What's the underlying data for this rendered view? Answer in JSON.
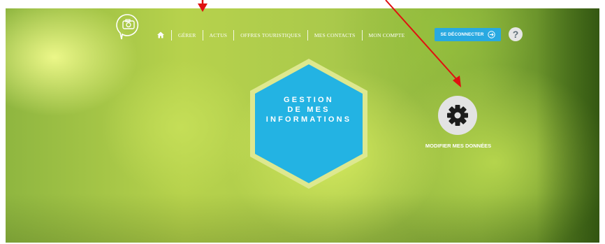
{
  "nav": {
    "home_icon": "home-icon",
    "items": [
      "GÉRER",
      "ACTUS",
      "OFFRES TOURISTIQUES",
      "MES CONTACTS",
      "MON COMPTE"
    ]
  },
  "header": {
    "logo_icon": "camera-bubble-icon",
    "logout_label": "SE DÉCONNECTER",
    "logout_icon": "arrow-circle-right-icon",
    "help_label": "?"
  },
  "main": {
    "hexagon_lines": [
      "GESTION",
      "DE MES",
      "INFORMATIONS"
    ],
    "settings_icon": "gear-icon",
    "settings_label": "MODIFIER MES DONNÉES"
  },
  "colors": {
    "accent_blue": "#29a9e1",
    "hex_border": "#d9e68a",
    "annotation_red": "#e01010"
  }
}
